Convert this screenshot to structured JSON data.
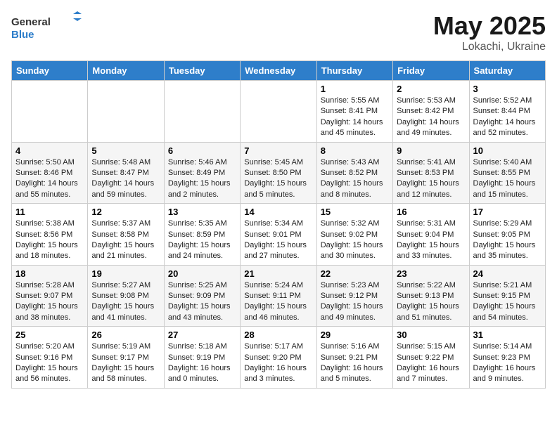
{
  "header": {
    "logo_general": "General",
    "logo_blue": "Blue",
    "month": "May 2025",
    "location": "Lokachi, Ukraine"
  },
  "weekdays": [
    "Sunday",
    "Monday",
    "Tuesday",
    "Wednesday",
    "Thursday",
    "Friday",
    "Saturday"
  ],
  "weeks": [
    [
      {
        "day": "",
        "info": ""
      },
      {
        "day": "",
        "info": ""
      },
      {
        "day": "",
        "info": ""
      },
      {
        "day": "",
        "info": ""
      },
      {
        "day": "1",
        "info": "Sunrise: 5:55 AM\nSunset: 8:41 PM\nDaylight: 14 hours\nand 45 minutes."
      },
      {
        "day": "2",
        "info": "Sunrise: 5:53 AM\nSunset: 8:42 PM\nDaylight: 14 hours\nand 49 minutes."
      },
      {
        "day": "3",
        "info": "Sunrise: 5:52 AM\nSunset: 8:44 PM\nDaylight: 14 hours\nand 52 minutes."
      }
    ],
    [
      {
        "day": "4",
        "info": "Sunrise: 5:50 AM\nSunset: 8:46 PM\nDaylight: 14 hours\nand 55 minutes."
      },
      {
        "day": "5",
        "info": "Sunrise: 5:48 AM\nSunset: 8:47 PM\nDaylight: 14 hours\nand 59 minutes."
      },
      {
        "day": "6",
        "info": "Sunrise: 5:46 AM\nSunset: 8:49 PM\nDaylight: 15 hours\nand 2 minutes."
      },
      {
        "day": "7",
        "info": "Sunrise: 5:45 AM\nSunset: 8:50 PM\nDaylight: 15 hours\nand 5 minutes."
      },
      {
        "day": "8",
        "info": "Sunrise: 5:43 AM\nSunset: 8:52 PM\nDaylight: 15 hours\nand 8 minutes."
      },
      {
        "day": "9",
        "info": "Sunrise: 5:41 AM\nSunset: 8:53 PM\nDaylight: 15 hours\nand 12 minutes."
      },
      {
        "day": "10",
        "info": "Sunrise: 5:40 AM\nSunset: 8:55 PM\nDaylight: 15 hours\nand 15 minutes."
      }
    ],
    [
      {
        "day": "11",
        "info": "Sunrise: 5:38 AM\nSunset: 8:56 PM\nDaylight: 15 hours\nand 18 minutes."
      },
      {
        "day": "12",
        "info": "Sunrise: 5:37 AM\nSunset: 8:58 PM\nDaylight: 15 hours\nand 21 minutes."
      },
      {
        "day": "13",
        "info": "Sunrise: 5:35 AM\nSunset: 8:59 PM\nDaylight: 15 hours\nand 24 minutes."
      },
      {
        "day": "14",
        "info": "Sunrise: 5:34 AM\nSunset: 9:01 PM\nDaylight: 15 hours\nand 27 minutes."
      },
      {
        "day": "15",
        "info": "Sunrise: 5:32 AM\nSunset: 9:02 PM\nDaylight: 15 hours\nand 30 minutes."
      },
      {
        "day": "16",
        "info": "Sunrise: 5:31 AM\nSunset: 9:04 PM\nDaylight: 15 hours\nand 33 minutes."
      },
      {
        "day": "17",
        "info": "Sunrise: 5:29 AM\nSunset: 9:05 PM\nDaylight: 15 hours\nand 35 minutes."
      }
    ],
    [
      {
        "day": "18",
        "info": "Sunrise: 5:28 AM\nSunset: 9:07 PM\nDaylight: 15 hours\nand 38 minutes."
      },
      {
        "day": "19",
        "info": "Sunrise: 5:27 AM\nSunset: 9:08 PM\nDaylight: 15 hours\nand 41 minutes."
      },
      {
        "day": "20",
        "info": "Sunrise: 5:25 AM\nSunset: 9:09 PM\nDaylight: 15 hours\nand 43 minutes."
      },
      {
        "day": "21",
        "info": "Sunrise: 5:24 AM\nSunset: 9:11 PM\nDaylight: 15 hours\nand 46 minutes."
      },
      {
        "day": "22",
        "info": "Sunrise: 5:23 AM\nSunset: 9:12 PM\nDaylight: 15 hours\nand 49 minutes."
      },
      {
        "day": "23",
        "info": "Sunrise: 5:22 AM\nSunset: 9:13 PM\nDaylight: 15 hours\nand 51 minutes."
      },
      {
        "day": "24",
        "info": "Sunrise: 5:21 AM\nSunset: 9:15 PM\nDaylight: 15 hours\nand 54 minutes."
      }
    ],
    [
      {
        "day": "25",
        "info": "Sunrise: 5:20 AM\nSunset: 9:16 PM\nDaylight: 15 hours\nand 56 minutes."
      },
      {
        "day": "26",
        "info": "Sunrise: 5:19 AM\nSunset: 9:17 PM\nDaylight: 15 hours\nand 58 minutes."
      },
      {
        "day": "27",
        "info": "Sunrise: 5:18 AM\nSunset: 9:19 PM\nDaylight: 16 hours\nand 0 minutes."
      },
      {
        "day": "28",
        "info": "Sunrise: 5:17 AM\nSunset: 9:20 PM\nDaylight: 16 hours\nand 3 minutes."
      },
      {
        "day": "29",
        "info": "Sunrise: 5:16 AM\nSunset: 9:21 PM\nDaylight: 16 hours\nand 5 minutes."
      },
      {
        "day": "30",
        "info": "Sunrise: 5:15 AM\nSunset: 9:22 PM\nDaylight: 16 hours\nand 7 minutes."
      },
      {
        "day": "31",
        "info": "Sunrise: 5:14 AM\nSunset: 9:23 PM\nDaylight: 16 hours\nand 9 minutes."
      }
    ]
  ]
}
